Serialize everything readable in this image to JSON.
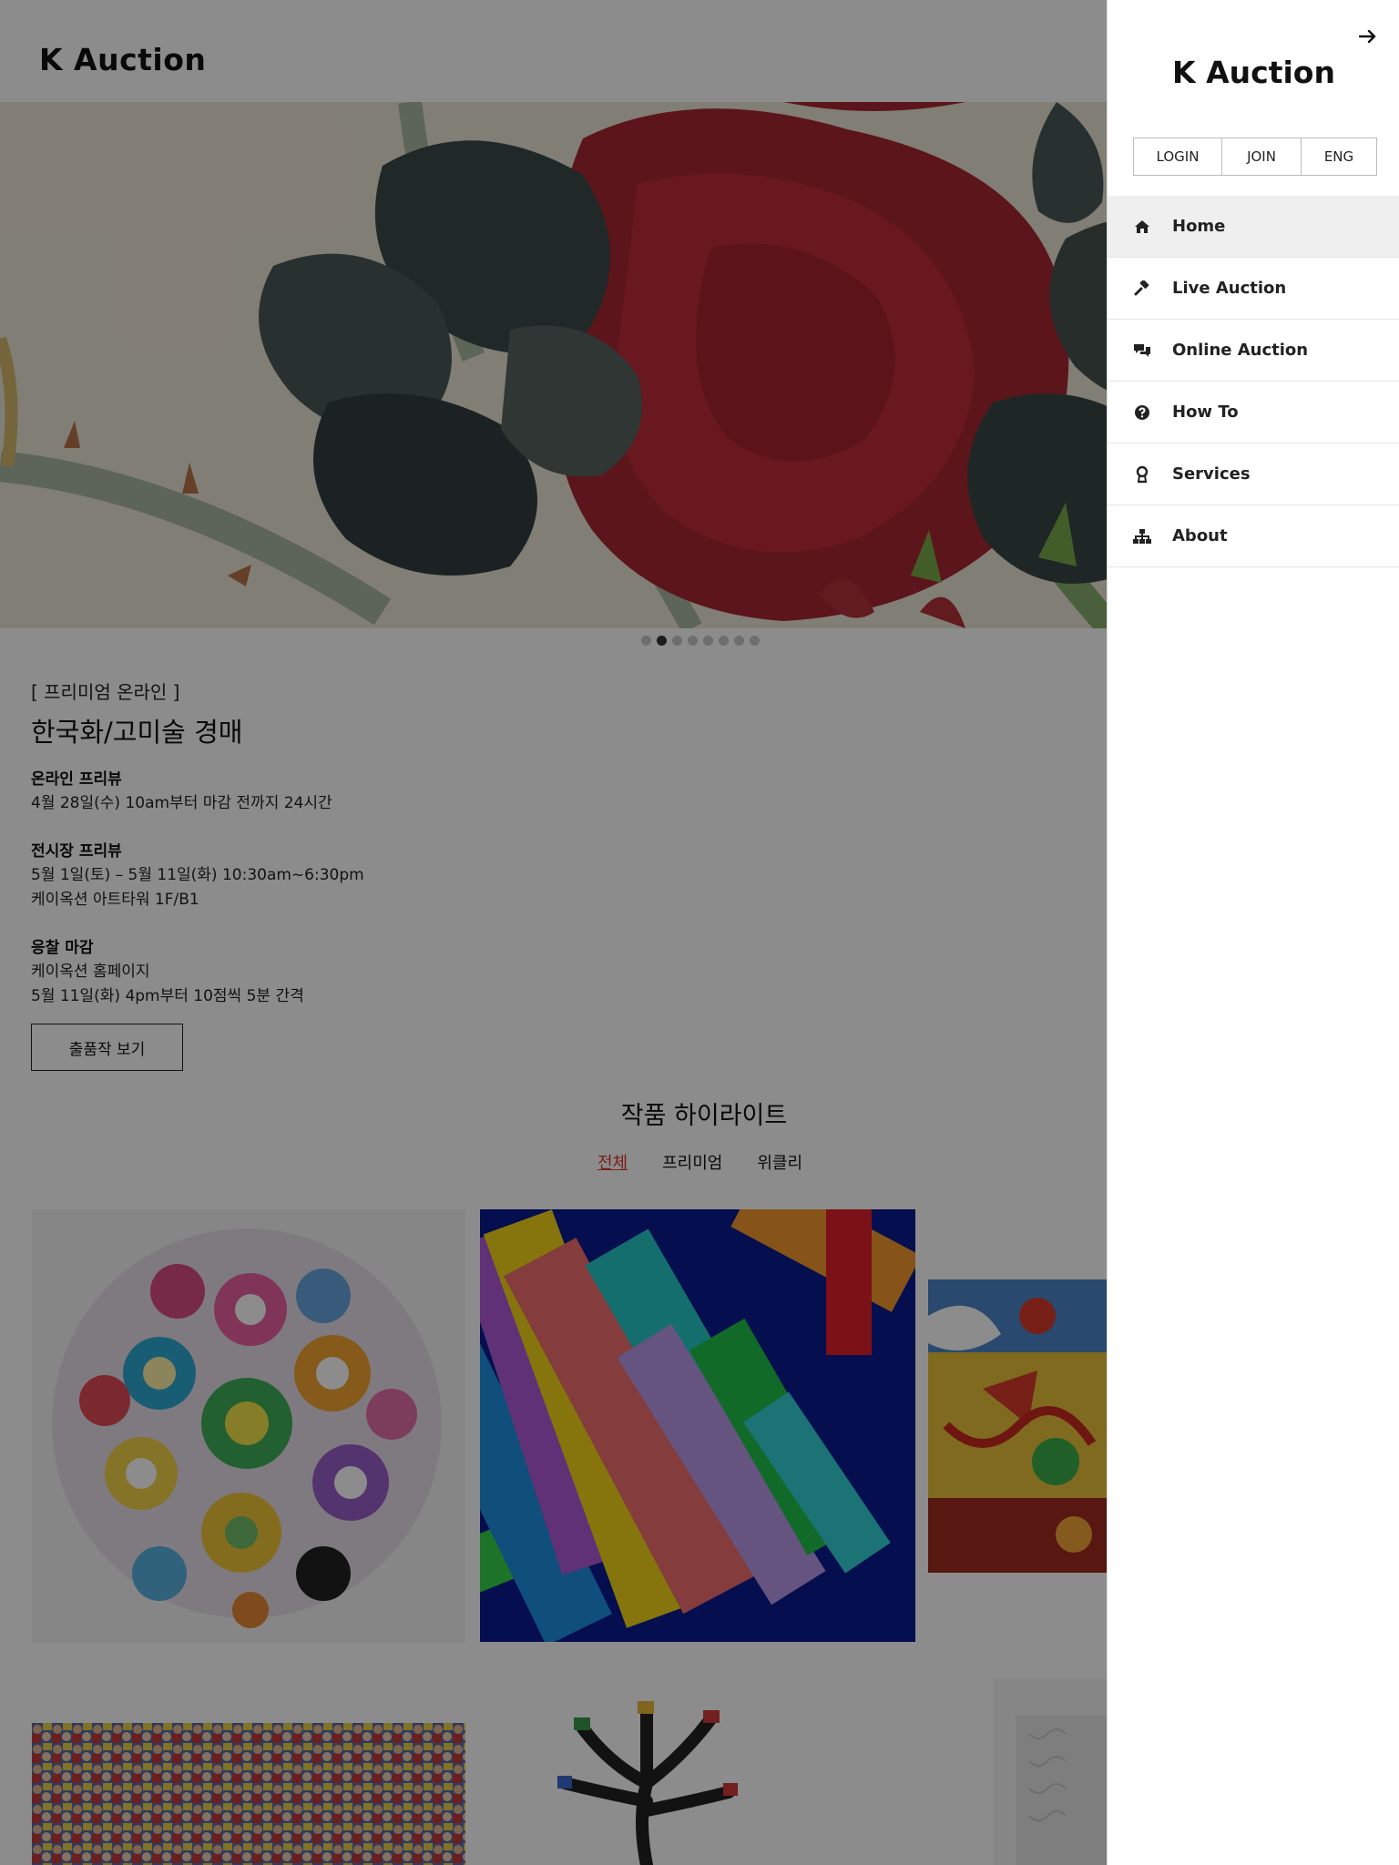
{
  "header": {
    "logo": "K Auction"
  },
  "carousel": {
    "slide_count": 8,
    "active_index": 1
  },
  "auction": {
    "kicker": "[ 프리미엄 온라인 ]",
    "title": "한국화/고미술 경매",
    "online_preview": {
      "title": "온라인 프리뷰",
      "lines": [
        "4월 28일(수) 10am부터 마감 전까지 24시간"
      ]
    },
    "exhibition_preview": {
      "title": "전시장 프리뷰",
      "lines": [
        "5월 1일(토) – 5월 11일(화) 10:30am~6:30pm",
        "케이옥션 아트타워 1F/B1"
      ]
    },
    "bid_close": {
      "title": "응찰 마감",
      "lines": [
        "케이옥션 홈페이지",
        "5월 11일(화) 4pm부터 10점씩 5분 간격"
      ]
    },
    "view_button": "출품작 보기"
  },
  "highlights": {
    "title": "작품 하이라이트",
    "tabs": [
      {
        "label": "전체",
        "active": true
      },
      {
        "label": "프리미엄",
        "active": false
      },
      {
        "label": "위클리",
        "active": false
      }
    ]
  },
  "drawer": {
    "logo": "K Auction",
    "close_icon": "arrow-right-icon",
    "auth": {
      "login": "LOGIN",
      "join": "JOIN",
      "lang": "ENG"
    },
    "menu": [
      {
        "label": "Home",
        "icon": "home-icon",
        "active": true
      },
      {
        "label": "Live Auction",
        "icon": "gavel-icon",
        "active": false
      },
      {
        "label": "Online Auction",
        "icon": "chat-icon",
        "active": false
      },
      {
        "label": "How To",
        "icon": "question-circle-icon",
        "active": false
      },
      {
        "label": "Services",
        "icon": "award-icon",
        "active": false
      },
      {
        "label": "About",
        "icon": "sitemap-icon",
        "active": false
      }
    ]
  },
  "colors": {
    "accent": "#d9372b",
    "overlay": "rgba(0,0,0,0.45)",
    "menu_active_bg": "#efefef"
  }
}
